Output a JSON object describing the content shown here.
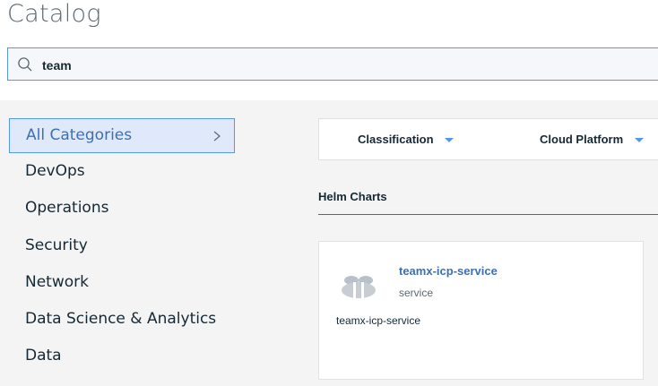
{
  "page": {
    "title": "Catalog"
  },
  "search": {
    "value": "team",
    "placeholder": ""
  },
  "sidebar": {
    "items": [
      {
        "label": "All Categories",
        "active": true
      },
      {
        "label": "DevOps"
      },
      {
        "label": "Operations"
      },
      {
        "label": "Security"
      },
      {
        "label": "Network"
      },
      {
        "label": "Data Science & Analytics"
      },
      {
        "label": "Data"
      }
    ]
  },
  "filters": {
    "classification": "Classification",
    "cloud_platform": "Cloud Platform"
  },
  "section": {
    "title": "Helm Charts"
  },
  "cards": [
    {
      "title": "teamx-icp-service",
      "subtitle": "service",
      "description": "teamx-icp-service",
      "icon": "bee-logo-icon"
    }
  ],
  "colors": {
    "accent": "#5596e6",
    "link": "#3d70b2",
    "active_bg": "#dfe9f9",
    "page_bg": "#f4f4f4",
    "text": "#152935"
  }
}
